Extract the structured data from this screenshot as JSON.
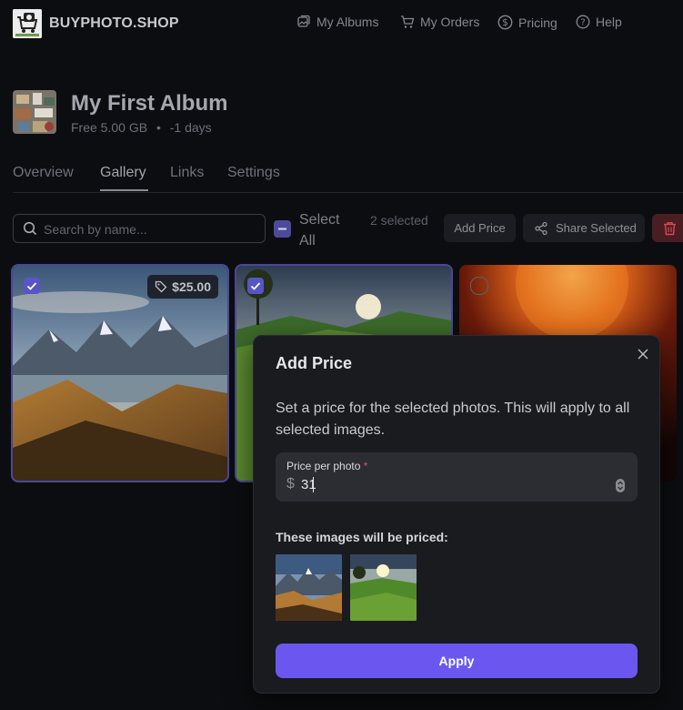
{
  "brand": {
    "name": "BUYPHOTO.SHOP"
  },
  "nav": {
    "albums": "My Albums",
    "orders": "My Orders",
    "pricing": "Pricing",
    "help": "Help"
  },
  "album": {
    "title": "My First Album",
    "storage": "Free 5.00 GB",
    "separator": "•",
    "days": "-1 days"
  },
  "tabs": {
    "overview": "Overview",
    "gallery": "Gallery",
    "links": "Links",
    "settings": "Settings",
    "active": "Gallery"
  },
  "toolbar": {
    "search_placeholder": "Search by name...",
    "select_all": "Select All",
    "selected_count": "2 selected",
    "add_price": "Add Price",
    "share_selected": "Share Selected"
  },
  "photos": [
    {
      "name": "mountain",
      "selected": true,
      "price": "$25.00"
    },
    {
      "name": "meadow-sunset",
      "selected": true
    },
    {
      "name": "sun",
      "selected": false
    }
  ],
  "modal": {
    "title": "Add Price",
    "description": "Set a price for the selected photos. This will apply to all selected images.",
    "field_label": "Price per photo",
    "required_mark": "*",
    "currency": "$",
    "value": "31",
    "preview_label": "These images will be priced:",
    "apply": "Apply"
  },
  "colors": {
    "accent": "#6b57f0",
    "selected_border": "#4b4794",
    "danger": "#4a1d22"
  }
}
